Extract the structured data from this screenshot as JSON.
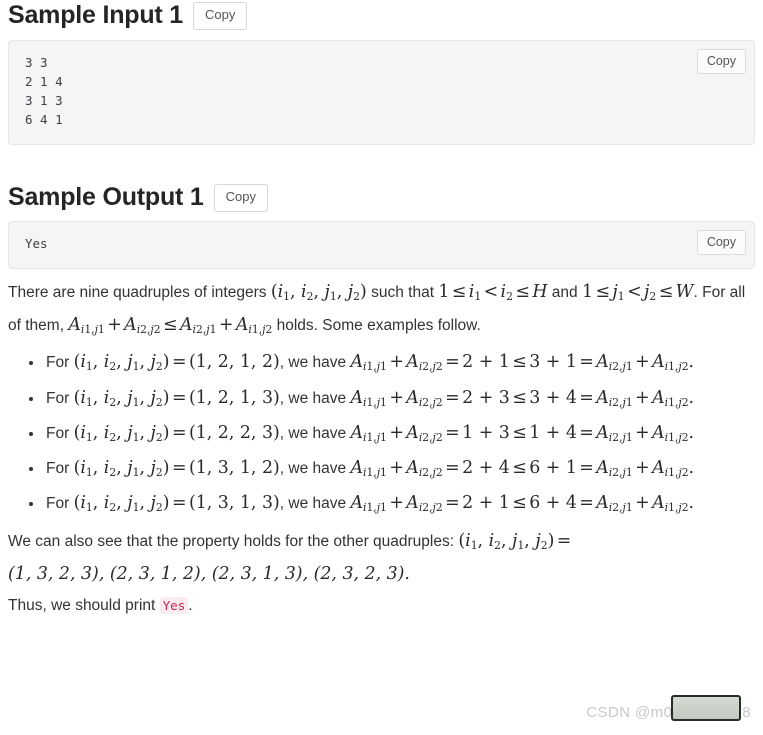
{
  "sections": [
    {
      "title": "Sample Input 1",
      "copy_label": "Copy",
      "block_copy_label": "Copy",
      "code": "3 3\n2 1 4\n3 1 3\n6 4 1"
    },
    {
      "title": "Sample Output 1",
      "copy_label": "Copy",
      "block_copy_label": "Copy",
      "code": "Yes"
    }
  ],
  "explanation": {
    "intro": {
      "t1": "There are nine quadruples of integers ",
      "m1": "(i1, i2, j1, j2)",
      "t2": " such that ",
      "m2": "1 ≤ i1 < i2 ≤ H",
      "t3": " and ",
      "m3": "1 ≤ j1 < j2 ≤ W",
      "t4": ". For all of them, ",
      "m4": "A(i1,j1) + A(i2,j2) ≤ A(i2,j1) + A(i1,j2)",
      "t5": " holds. Some examples follow."
    },
    "examples": [
      {
        "prefix": "For ",
        "quadruple_symbol": "(i1, i2, j1, j2)",
        "equals": " = ",
        "quadruple_value": "(1, 2, 1, 2)",
        "middle": ", we have ",
        "lhs": "A(i1,j1) + A(i2,j2)",
        "relation_eq": " = ",
        "lhs_value": "2 + 1",
        "relation_le": " ≤ ",
        "rhs_value": "3 + 1",
        "tail_eq": " = ",
        "rhs": "A(i2,j1) + A(i1,j2)",
        "period": "."
      },
      {
        "prefix": "For ",
        "quadruple_symbol": "(i1, i2, j1, j2)",
        "equals": " = ",
        "quadruple_value": "(1, 2, 1, 3)",
        "middle": ", we have ",
        "lhs": "A(i1,j1) + A(i2,j2)",
        "relation_eq": " = ",
        "lhs_value": "2 + 3",
        "relation_le": " ≤ ",
        "rhs_value": "3 + 4",
        "tail_eq": " = ",
        "rhs": "A(i2,j1) + A(i1,j2)",
        "period": "."
      },
      {
        "prefix": "For ",
        "quadruple_symbol": "(i1, i2, j1, j2)",
        "equals": " = ",
        "quadruple_value": "(1, 2, 2, 3)",
        "middle": ", we have ",
        "lhs": "A(i1,j1) + A(i2,j2)",
        "relation_eq": " = ",
        "lhs_value": "1 + 3",
        "relation_le": " ≤ ",
        "rhs_value": "1 + 4",
        "tail_eq": " = ",
        "rhs": "A(i2,j1) + A(i1,j2)",
        "period": "."
      },
      {
        "prefix": "For ",
        "quadruple_symbol": "(i1, i2, j1, j2)",
        "equals": " = ",
        "quadruple_value": "(1, 3, 1, 2)",
        "middle": ", we have ",
        "lhs": "A(i1,j1) + A(i2,j2)",
        "relation_eq": " = ",
        "lhs_value": "2 + 4",
        "relation_le": " ≤ ",
        "rhs_value": "6 + 1",
        "tail_eq": " = ",
        "rhs": "A(i2,j1) + A(i1,j2)",
        "period": "."
      },
      {
        "prefix": "For ",
        "quadruple_symbol": "(i1, i2, j1, j2)",
        "equals": " = ",
        "quadruple_value": "(1, 3, 1, 3)",
        "middle": ", we have ",
        "lhs": "A(i1,j1) + A(i2,j2)",
        "relation_eq": " = ",
        "lhs_value": "2 + 1",
        "relation_le": " ≤ ",
        "rhs_value": "6 + 4",
        "tail_eq": " = ",
        "rhs": "A(i2,j1) + A(i1,j2)",
        "period": "."
      }
    ],
    "others": {
      "lead": "We can also see that the property holds for the other quadruples: ",
      "symbol": "(i1, i2, j1, j2)",
      "equals": " = ",
      "list": "(1, 3, 2, 3), (2, 3, 1, 2), (2, 3, 1, 3), (2, 3, 2, 3)."
    },
    "conclusion": {
      "lead": "Thus, we should print ",
      "code": "Yes",
      "tail": "."
    }
  },
  "watermark": {
    "text": "CSDN @m0_73618658"
  },
  "colors": {
    "heading": "#252525",
    "body": "#333333",
    "code_bg": "#f5f5f5",
    "code_border": "#e6e6e6",
    "inline_code_bg": "#fdecef",
    "inline_code_fg": "#c7254e",
    "watermark": "#c9c9c9"
  }
}
